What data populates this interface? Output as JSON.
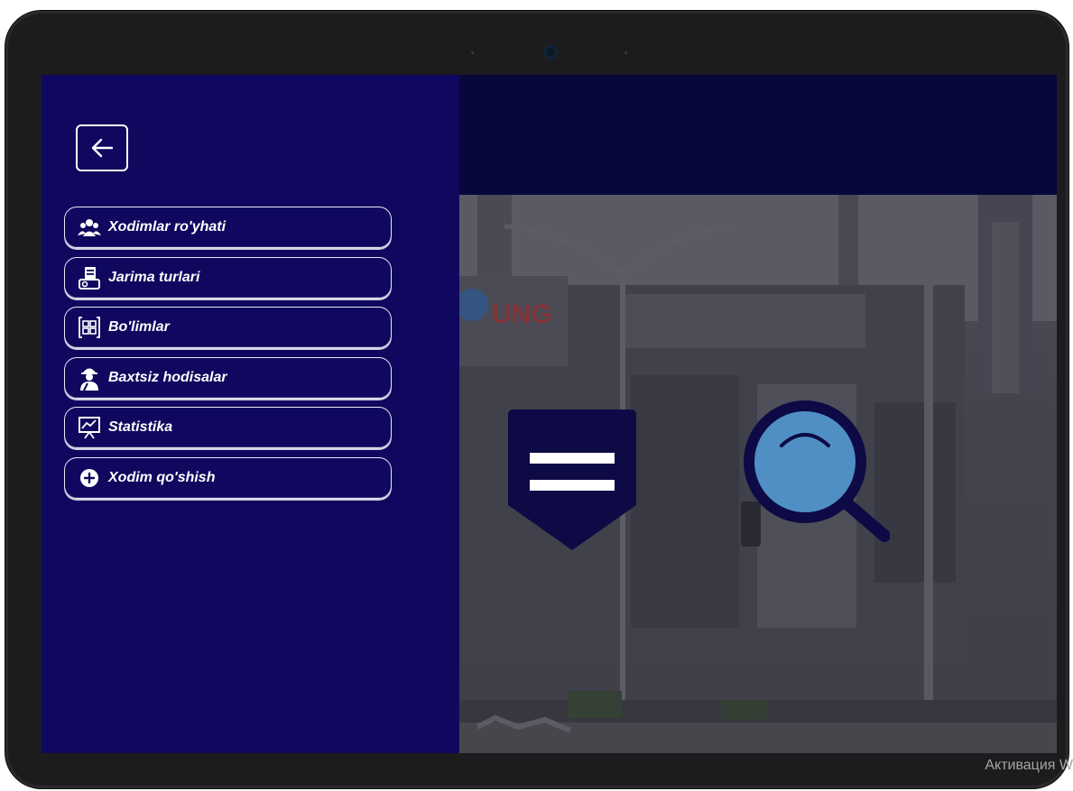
{
  "sidebar": {
    "back_icon": "arrow-left-icon",
    "items": [
      {
        "label": "Xodimlar ro'yhati",
        "icon": "employees-group-icon"
      },
      {
        "label": "Jarima turlari",
        "icon": "fine-document-icon"
      },
      {
        "label": "Bo'limlar",
        "icon": "departments-grid-icon"
      },
      {
        "label": "Baxtsiz hodisalar",
        "icon": "injured-worker-icon"
      },
      {
        "label": "Statistika",
        "icon": "statistics-chart-icon"
      },
      {
        "label": "Xodim qo'shish",
        "icon": "add-circle-icon"
      }
    ]
  },
  "main": {
    "logo_text": "UNG",
    "center_icons": [
      "shield-document-icon",
      "search-icon"
    ]
  },
  "system": {
    "activation_text": "Активация W"
  },
  "colors": {
    "sidebar_bg": "#10085f",
    "topbar_bg": "#08073a",
    "shield_color": "#0d0a45",
    "magnifier_lens": "#4f8fc4"
  }
}
